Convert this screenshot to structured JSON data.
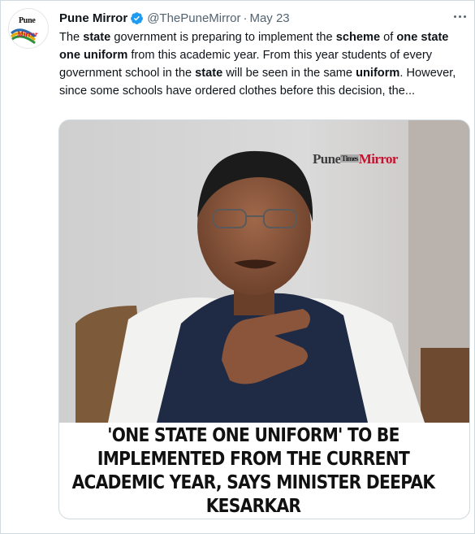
{
  "tweet": {
    "account_name": "Pune Mirror",
    "handle": "@ThePuneMirror",
    "separator": "·",
    "date": "May 23",
    "avatar_logo": {
      "line1": "Pune",
      "line2": "Mirror"
    },
    "text_segments": [
      {
        "t": "The ",
        "b": false
      },
      {
        "t": "state",
        "b": true
      },
      {
        "t": " government is preparing to implement the ",
        "b": false
      },
      {
        "t": "scheme",
        "b": true
      },
      {
        "t": " of ",
        "b": false
      },
      {
        "t": "one state one uniform",
        "b": true
      },
      {
        "t": " from this academic year. From this year students of every government school in the ",
        "b": false
      },
      {
        "t": "state",
        "b": true
      },
      {
        "t": " will be seen in the same ",
        "b": false
      },
      {
        "t": "uniform",
        "b": true
      },
      {
        "t": ". However, since some schools have ordered clothes before this decision, the...",
        "b": false
      }
    ]
  },
  "media": {
    "watermark": {
      "part1": "Pune",
      "part2": "Times",
      "part3": "Mirror"
    },
    "headline": "'ONE STATE ONE UNIFORM' TO BE IMPLEMENTED FROM THE CURRENT ACADEMIC YEAR, SAYS MINISTER DEEPAK KESARKAR"
  },
  "colors": {
    "verified": "#1d9bf0",
    "secondary_text": "#536471",
    "brand_red": "#c8102e",
    "border": "#cfd9de"
  },
  "icons": [
    "verified-badge-icon",
    "more-options-icon"
  ]
}
